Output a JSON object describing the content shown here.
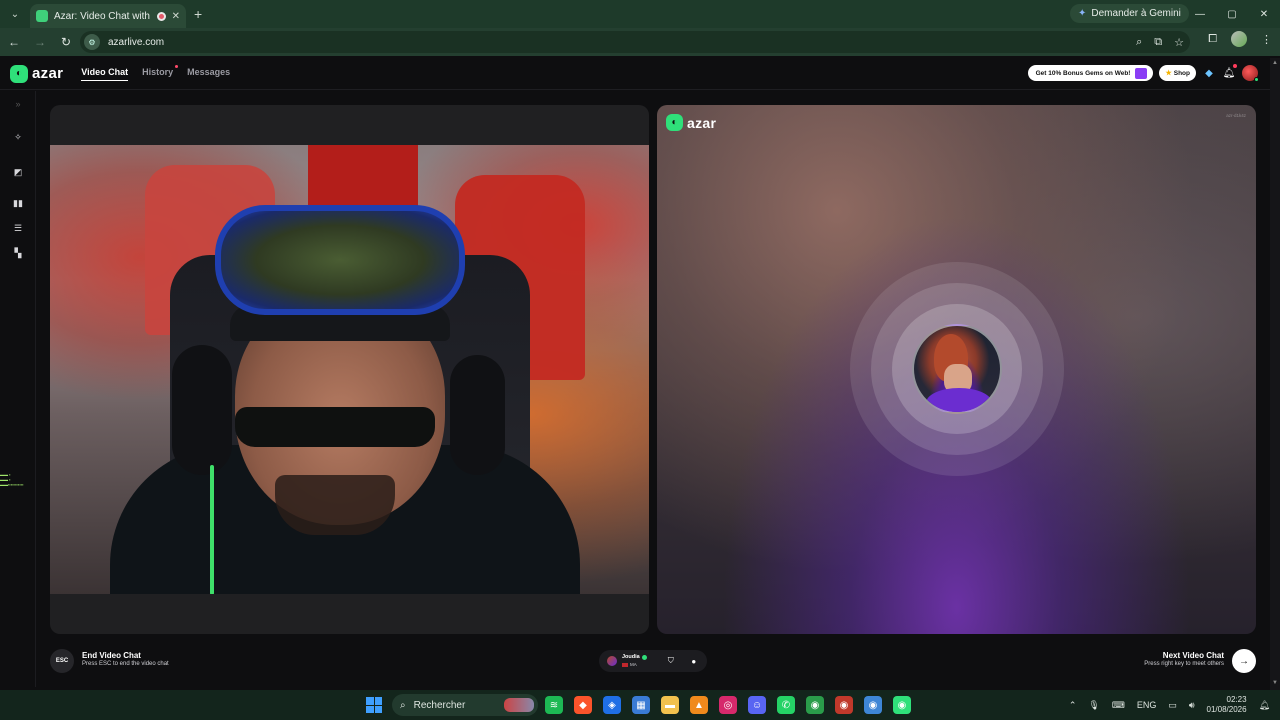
{
  "browser": {
    "tab_title": "Azar: Video Chat with New",
    "new_tab": "+",
    "gemini_label": "Demander à Gemini",
    "url": "azarlive.com",
    "window_controls": [
      "—",
      "▢",
      "✕"
    ]
  },
  "header": {
    "logo_text": "azar",
    "nav": [
      {
        "label": "Video Chat",
        "active": true
      },
      {
        "label": "History",
        "active": false,
        "dot": true
      },
      {
        "label": "Messages",
        "active": false
      }
    ],
    "promo_label": "Get 10% Bonus Gems on Web!",
    "shop_label": "Shop"
  },
  "rail": {
    "items": [
      "expand-icon",
      "magic-wand-icon",
      "filter-icon",
      "layout-split-icon",
      "layout-stack-icon",
      "layout-grid-icon"
    ]
  },
  "right_panel": {
    "logo_text": "azar",
    "watermark": "azr-d1k4z"
  },
  "bottom": {
    "esc_label": "ESC",
    "end_title": "End Video Chat",
    "end_subtitle": "Press ESC to end the video chat",
    "peer_name": "Joudia",
    "peer_country": "MA",
    "next_title": "Next Video Chat",
    "next_subtitle": "Press right key to meet others"
  },
  "taskbar": {
    "search_label": "Rechercher",
    "language": "ENG",
    "time": "02:23",
    "date": "01/08/2026",
    "apps": [
      {
        "name": "spotify",
        "color": "#1db954",
        "glyph": "≋"
      },
      {
        "name": "brave",
        "color": "#fb542b",
        "glyph": "◆"
      },
      {
        "name": "defender",
        "color": "#1f6fe5",
        "glyph": "◈"
      },
      {
        "name": "store",
        "color": "#3a7bd5",
        "glyph": "▦"
      },
      {
        "name": "explorer",
        "color": "#f2c14e",
        "glyph": "▬"
      },
      {
        "name": "vlc",
        "color": "#f08a1c",
        "glyph": "▲"
      },
      {
        "name": "instagram",
        "color": "#d6296b",
        "glyph": "◎"
      },
      {
        "name": "discord",
        "color": "#5865f2",
        "glyph": "☺"
      },
      {
        "name": "whatsapp",
        "color": "#25d366",
        "glyph": "✆"
      },
      {
        "name": "chrome",
        "color": "#2a9d4a",
        "glyph": "◉"
      },
      {
        "name": "chrome-profile-2",
        "color": "#c0392b",
        "glyph": "◉"
      },
      {
        "name": "chrome-profile-3",
        "color": "#3e86d6",
        "glyph": "◉"
      },
      {
        "name": "chrome-active",
        "color": "#2fe07a",
        "glyph": "◉"
      }
    ]
  },
  "colors": {
    "brand_green": "#2fe07a",
    "chrome_dark_green": "#1e3a2a"
  }
}
